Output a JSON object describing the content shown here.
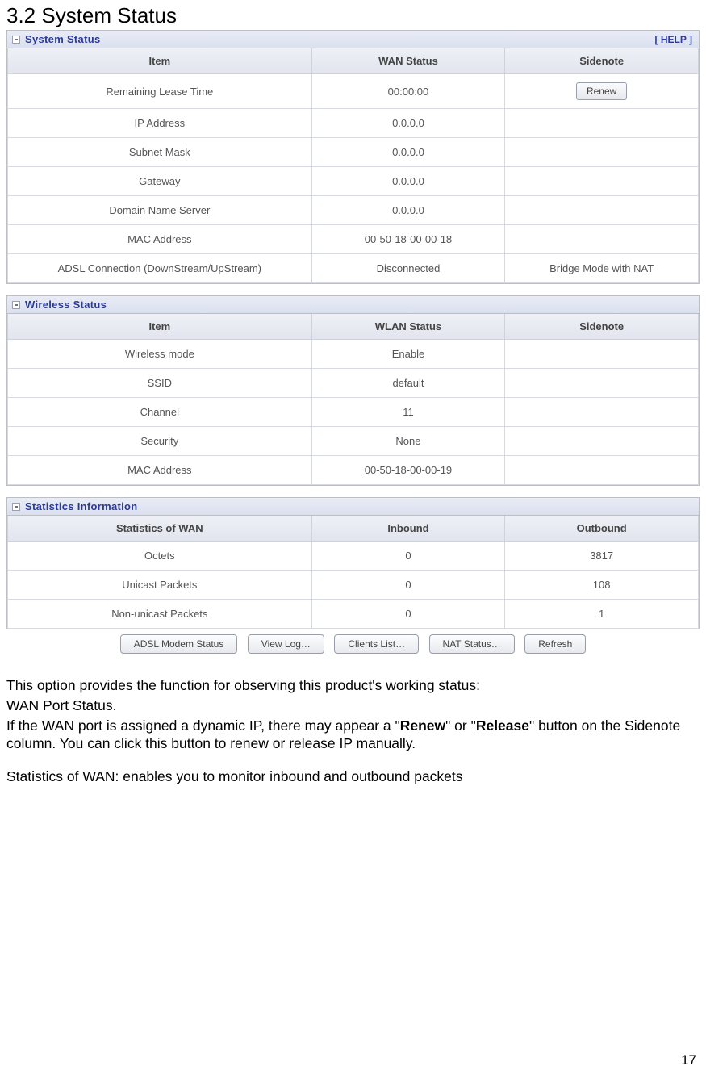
{
  "heading": "3.2 System Status",
  "help_label": "[ HELP ]",
  "renew_button": "Renew",
  "system_status": {
    "title": "System Status",
    "headers": [
      "Item",
      "WAN Status",
      "Sidenote"
    ],
    "rows": [
      {
        "item": "Remaining Lease Time",
        "status": "00:00:00",
        "side_button": true
      },
      {
        "item": "IP Address",
        "status": "0.0.0.0",
        "side": ""
      },
      {
        "item": "Subnet Mask",
        "status": "0.0.0.0",
        "side": ""
      },
      {
        "item": "Gateway",
        "status": "0.0.0.0",
        "side": ""
      },
      {
        "item": "Domain Name Server",
        "status": "0.0.0.0",
        "side": ""
      },
      {
        "item": "MAC Address",
        "status": "00-50-18-00-00-18",
        "side": ""
      },
      {
        "item": "ADSL Connection (DownStream/UpStream)",
        "status": "Disconnected",
        "side": "Bridge Mode with NAT"
      }
    ]
  },
  "wireless_status": {
    "title": "Wireless Status",
    "headers": [
      "Item",
      "WLAN Status",
      "Sidenote"
    ],
    "rows": [
      {
        "item": "Wireless mode",
        "status": "Enable",
        "side": ""
      },
      {
        "item": "SSID",
        "status": "default",
        "side": ""
      },
      {
        "item": "Channel",
        "status": "11",
        "side": ""
      },
      {
        "item": "Security",
        "status": "None",
        "side": ""
      },
      {
        "item": "MAC Address",
        "status": "00-50-18-00-00-19",
        "side": ""
      }
    ]
  },
  "statistics": {
    "title": "Statistics Information",
    "headers": [
      "Statistics of WAN",
      "Inbound",
      "Outbound"
    ],
    "rows": [
      {
        "item": "Octets",
        "in": "0",
        "out": "3817"
      },
      {
        "item": "Unicast Packets",
        "in": "0",
        "out": "108"
      },
      {
        "item": "Non-unicast Packets",
        "in": "0",
        "out": "1"
      }
    ]
  },
  "footer_buttons": [
    "ADSL Modem Status",
    "View Log…",
    "Clients List…",
    "NAT Status…",
    "Refresh"
  ],
  "body": {
    "p1": "This option provides the function for observing this product's working status:",
    "p2": "WAN Port Status.",
    "p3a": "If the WAN port is assigned a dynamic IP, there may appear a \"",
    "p3b": "Renew",
    "p3c": "\" or \"",
    "p3d": "Release",
    "p3e": "\" button on the Sidenote column. You can click this button to renew or release IP manually.",
    "p4": "Statistics of WAN: enables you to monitor inbound and outbound packets"
  },
  "page_number": "17"
}
